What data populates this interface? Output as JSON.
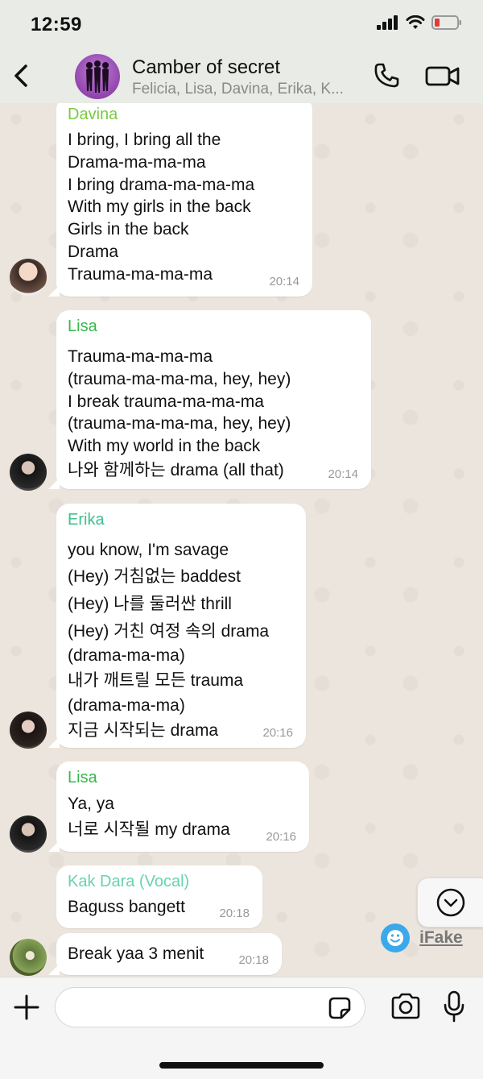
{
  "status": {
    "time": "12:59"
  },
  "header": {
    "title": "Camber of secret",
    "subtitle": "Felicia, Lisa, Davina, Erika, K..."
  },
  "colors": {
    "davina": "#7ac943",
    "lisa": "#35b84a",
    "erika": "#3ec08e",
    "kak_dara": "#67d3b2",
    "bubble": "#ffffff",
    "chat_bg": "#ece5dd"
  },
  "messages": [
    {
      "sender": "Davina",
      "lines": [
        "I bring, I bring all the",
        "Drama-ma-ma-ma",
        "I bring drama-ma-ma-ma",
        "With my girls in the back",
        "Girls in the back",
        "Drama",
        "Trauma-ma-ma-ma"
      ],
      "time": "20:14"
    },
    {
      "sender": "Lisa",
      "lines": [
        "Trauma-ma-ma-ma",
        "(trauma-ma-ma-ma, hey, hey)",
        "I break trauma-ma-ma-ma",
        "(trauma-ma-ma-ma, hey, hey)",
        "With my world in the back",
        "나와 함께하는 drama (all that)"
      ],
      "time": "20:14"
    },
    {
      "sender": "Erika",
      "lines": [
        "you know, I'm savage",
        "(Hey) 거침없는 baddest",
        "(Hey) 나를 둘러싼 thrill",
        "(Hey) 거친 여정 속의 drama",
        "(drama-ma-ma)",
        "내가 깨트릴 모든 trauma",
        "(drama-ma-ma)",
        "지금 시작되는 drama"
      ],
      "time": "20:16"
    },
    {
      "sender": "Lisa",
      "lines": [
        "Ya, ya",
        "너로 시작될 my drama"
      ],
      "time": "20:16"
    },
    {
      "sender": "Kak Dara (Vocal)",
      "lines": [
        "Baguss bangett"
      ],
      "time": "20:18"
    },
    {
      "sender": "",
      "lines": [
        "Break yaa 3 menit"
      ],
      "time": "20:18"
    }
  ],
  "watermark": {
    "label": "iFake"
  },
  "input": {
    "placeholder": ""
  },
  "icons": [
    "back-icon",
    "phone-icon",
    "video-call-icon",
    "chevron-down-icon",
    "plus-icon",
    "sticker-icon",
    "camera-icon",
    "microphone-icon",
    "signal-icon",
    "wifi-icon",
    "battery-icon"
  ]
}
